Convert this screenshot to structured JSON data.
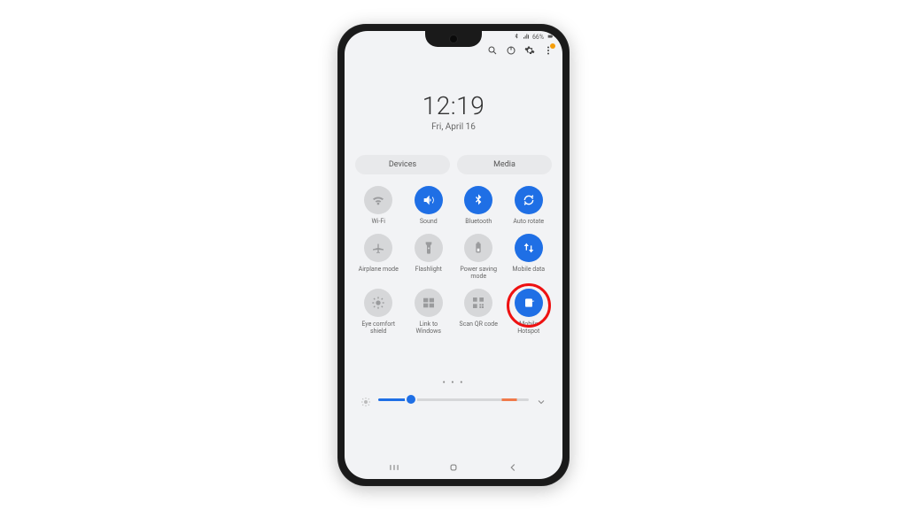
{
  "status": {
    "battery": "66%"
  },
  "clock": {
    "time": "12:19",
    "date": "Fri, April 16"
  },
  "pills": {
    "devices": "Devices",
    "media": "Media"
  },
  "tiles": [
    {
      "id": "wifi",
      "label": "Wi-Fi",
      "active": false
    },
    {
      "id": "sound",
      "label": "Sound",
      "active": true
    },
    {
      "id": "bluetooth",
      "label": "Bluetooth",
      "active": true
    },
    {
      "id": "autorotate",
      "label": "Auto rotate",
      "active": true
    },
    {
      "id": "airplane",
      "label": "Airplane mode",
      "active": false
    },
    {
      "id": "flashlight",
      "label": "Flashlight",
      "active": false
    },
    {
      "id": "powersave",
      "label": "Power saving mode",
      "active": false
    },
    {
      "id": "mobiledata",
      "label": "Mobile data",
      "active": true
    },
    {
      "id": "eyecomfort",
      "label": "Eye comfort shield",
      "active": false
    },
    {
      "id": "linkwindows",
      "label": "Link to Windows",
      "active": false
    },
    {
      "id": "scanqr",
      "label": "Scan QR code",
      "active": false
    },
    {
      "id": "hotspot",
      "label": "Mobile Hotspot",
      "active": true
    }
  ],
  "highlight_tile_index": 11,
  "brightness": {
    "percent": 22
  },
  "colors": {
    "accent": "#1f6fe5",
    "inactive": "#d6d7d9",
    "highlight": "#e11"
  }
}
